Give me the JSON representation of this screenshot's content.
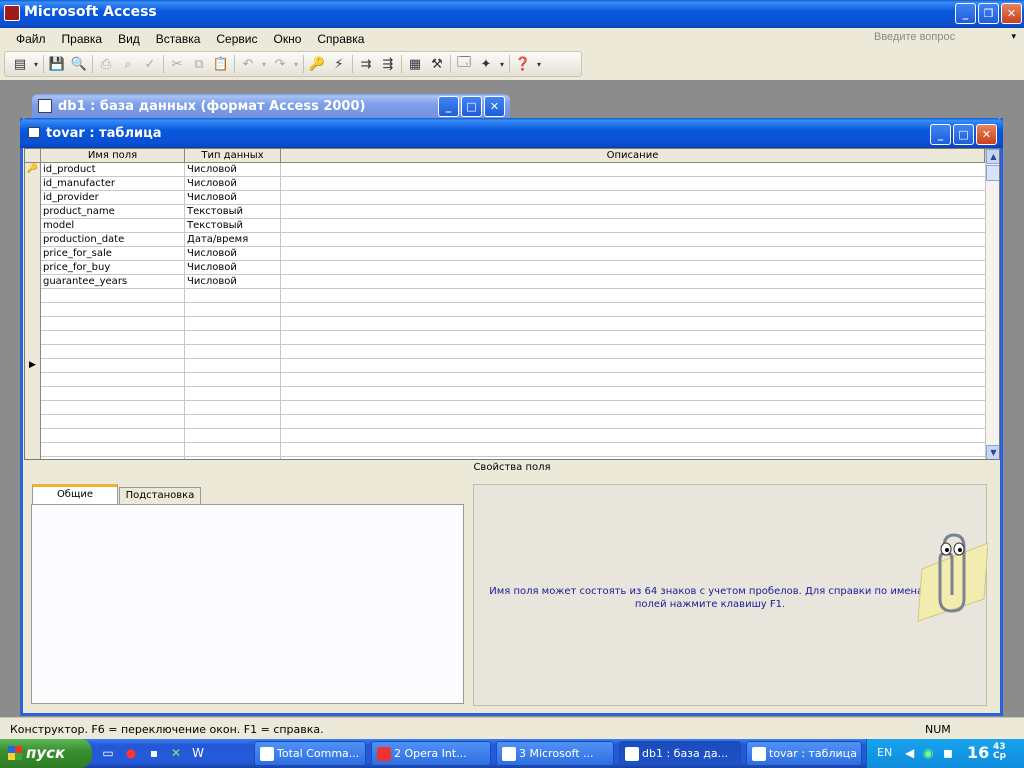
{
  "app": {
    "title": "Microsoft Access"
  },
  "menu": [
    "Файл",
    "Правка",
    "Вид",
    "Вставка",
    "Сервис",
    "Окно",
    "Справка"
  ],
  "help_box": {
    "placeholder": "Введите вопрос"
  },
  "db_window": {
    "title": "db1 : база данных (формат Access 2000)"
  },
  "table_window": {
    "title": "tovar : таблица"
  },
  "grid": {
    "headers": [
      "Имя поля",
      "Тип данных",
      "Описание"
    ],
    "rows": [
      {
        "name": "id_product",
        "type": "Числовой",
        "key": true
      },
      {
        "name": "id_manufacter",
        "type": "Числовой"
      },
      {
        "name": "id_provider",
        "type": "Числовой"
      },
      {
        "name": "product_name",
        "type": "Текстовый"
      },
      {
        "name": "model",
        "type": "Текстовый"
      },
      {
        "name": "production_date",
        "type": "Дата/время"
      },
      {
        "name": "price_for_sale",
        "type": "Числовой"
      },
      {
        "name": "price_for_buy",
        "type": "Числовой"
      },
      {
        "name": "guarantee_years",
        "type": "Числовой"
      }
    ],
    "empty_rows": 13,
    "current_row_index": 14
  },
  "properties": {
    "label": "Свойства поля",
    "tabs": [
      "Общие",
      "Подстановка"
    ],
    "hint": "Имя поля может состоять из 64 знаков с учетом пробелов.  Для справки по именам полей нажмите клавишу F1."
  },
  "status": {
    "text": "Конструктор.  F6 = переключение окон.  F1 = справка.",
    "num": "NUM"
  },
  "taskbar": {
    "start": "пуск",
    "tasks": [
      "Total Comma...",
      "2 Opera Int...",
      "3 Microsoft ...",
      "db1 : база да...",
      "tovar : таблица"
    ],
    "lang": "EN",
    "time": "16",
    "time_min": "43",
    "day": "Ср"
  },
  "colors": {
    "titlebar": "#0a4fd0",
    "workspace": "#8c8c8c",
    "hint_text": "#1a1a9c"
  }
}
